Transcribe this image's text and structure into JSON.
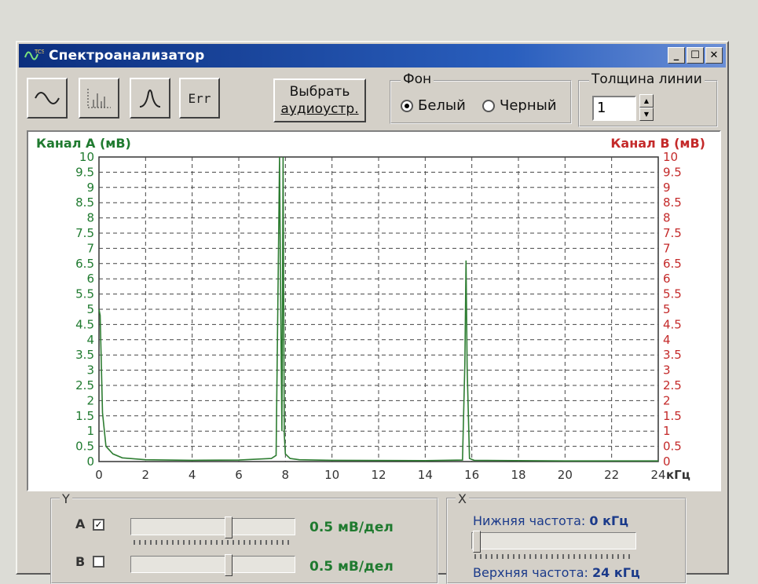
{
  "window": {
    "title": "Спектроанализатор",
    "icon": "tcs-wave-icon",
    "controls": {
      "minimize": "_",
      "maximize": "☐",
      "close": "✕"
    }
  },
  "toolbar": {
    "buttons": [
      {
        "name": "sine-wave-icon"
      },
      {
        "name": "spectrum-bars-icon"
      },
      {
        "name": "peak-curve-icon"
      },
      {
        "name": "err-button",
        "label": "Err"
      }
    ],
    "select_device": {
      "line1": "Выбрать",
      "line2": "аудиоустр."
    }
  },
  "background_group": {
    "legend": "Фон",
    "options": [
      {
        "label": "Белый",
        "selected": true
      },
      {
        "label": "Черный",
        "selected": false
      }
    ]
  },
  "line_width": {
    "legend": "Толщина линии",
    "value": "1"
  },
  "colors": {
    "channel_a": "#1f7a2f",
    "channel_b": "#c42a2a",
    "grid": "#444444",
    "trace": "#2e7d32"
  },
  "chart_data": {
    "type": "line",
    "ylabel": "Канал А (мВ)",
    "ylabel_right": "Канал В (мВ)",
    "xlabel": "кГц",
    "xlim": [
      0,
      24
    ],
    "ylim": [
      0,
      10
    ],
    "grid": true,
    "x_ticks": [
      "0",
      "2",
      "4",
      "6",
      "8",
      "10",
      "12",
      "14",
      "16",
      "18",
      "20",
      "22",
      "24"
    ],
    "y_ticks_left": [
      "0",
      "0.5",
      "1",
      "1.5",
      "2",
      "2.5",
      "3",
      "3.5",
      "4",
      "4.5",
      "5",
      "5.5",
      "6",
      "6.5",
      "7",
      "7.5",
      "8",
      "8.5",
      "9",
      "9.5",
      "10"
    ],
    "y_ticks_right": [
      "0",
      "0.5",
      "1",
      "1.5",
      "2",
      "2.5",
      "3",
      "3.5",
      "4",
      "4.5",
      "5",
      "5.5",
      "6",
      "6.5",
      "7",
      "7.5",
      "8",
      "8.5",
      "9",
      "9.5",
      "10"
    ],
    "series": [
      {
        "x": [
          0,
          0.05,
          0.15,
          0.3,
          0.6,
          1.0,
          2.0,
          4.0,
          6.0,
          7.4,
          7.6,
          7.75,
          7.8,
          7.85,
          7.9,
          7.95,
          8.0,
          8.2,
          8.6,
          10.0,
          14.0,
          15.6,
          15.7,
          15.75,
          15.8,
          15.9,
          16.1,
          20.0,
          24.0
        ],
        "y": [
          5.0,
          4.8,
          1.6,
          0.5,
          0.25,
          0.12,
          0.06,
          0.04,
          0.05,
          0.1,
          0.2,
          10.0,
          5.0,
          1.0,
          10.0,
          0.9,
          0.25,
          0.1,
          0.06,
          0.04,
          0.03,
          0.05,
          3.2,
          6.6,
          3.1,
          0.1,
          0.04,
          0.02,
          0.02
        ]
      }
    ]
  },
  "y_controls": {
    "legend": "Y",
    "row_a": {
      "label": "A",
      "checked": true,
      "check_mark": "✓",
      "scale": "0.5 мВ/дел"
    },
    "row_b": {
      "label": "B",
      "checked": false,
      "scale": "0.5 мВ/дел"
    }
  },
  "x_controls": {
    "legend": "X",
    "low_freq_label": "Нижняя частота:",
    "low_freq_value": "0 кГц",
    "high_freq_label": "Верхняя частота:",
    "high_freq_value": "24 кГц"
  }
}
